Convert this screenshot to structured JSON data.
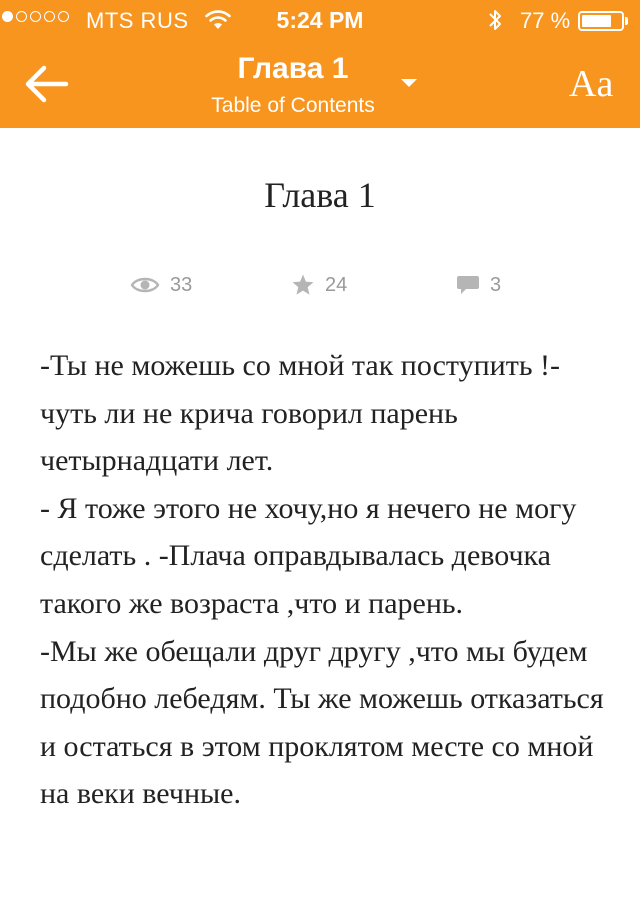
{
  "status_bar": {
    "carrier": "MTS RUS",
    "time": "5:24 PM",
    "battery": "77 %",
    "battery_level": 0.77,
    "signal_bars": 1
  },
  "nav": {
    "title": "Глава 1",
    "subtitle": "Table of Contents",
    "font_button": "Aa",
    "back_icon": "arrow-left-icon",
    "dropdown_icon": "caret-down-icon"
  },
  "chapter": {
    "title": "Глава 1",
    "stats": {
      "views": "33",
      "votes": "24",
      "comments": "3"
    },
    "paragraphs": [
      "-Ты не можешь со мной так поступить !- чуть ли не крича говорил парень четырнадцати лет.",
      "- Я тоже этого не хочу,но я нечего не могу сделать . -Плача оправдывалась девочка такого же возраста ,что и парень.",
      "-Мы же обещали друг другу ,что мы будем подобно лебедям. Ты же можешь отказаться и остаться в этом проклятом месте со мной на веки вечные."
    ]
  },
  "colors": {
    "header": "#f7951e",
    "header_text": "#ffffff",
    "body_text": "#222222",
    "stats": "#9a9a9a"
  }
}
